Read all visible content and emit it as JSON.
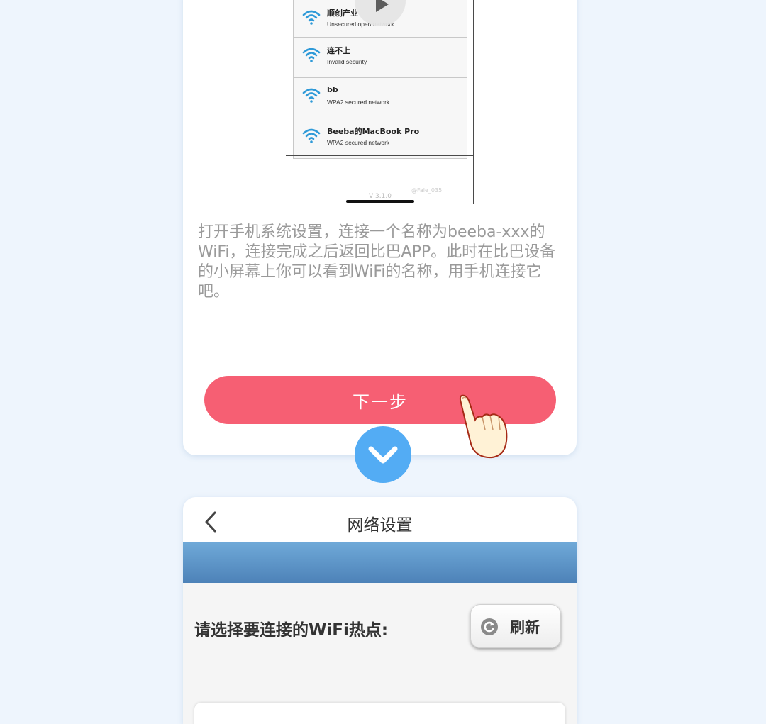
{
  "tutorial_step": {
    "wifi_networks": [
      {
        "name": "顺创产业",
        "status": "Unsecured open network"
      },
      {
        "name": "连不上",
        "status": "Invalid security"
      },
      {
        "name": "bb",
        "status": "WPA2 secured network"
      },
      {
        "name": "Beeba的MacBook Pro",
        "status": "WPA2 secured network"
      }
    ],
    "version": "V 3.1.0",
    "watermark": "@Fale_035",
    "instruction": "打开手机系统设置，连接一个名称为beeba-xxx的WiFi，连接完成之后返回比巴APP。此时在比巴设备的小屏幕上你可以看到WiFi的名称，用手机连接它吧。",
    "next_label": "下一步"
  },
  "network_settings": {
    "title": "网络设置",
    "prompt": "请选择要连接的WiFi热点:",
    "refresh_label": "刷新"
  },
  "colors": {
    "next_button": "#f65f73",
    "arrow_circle": "#53acf4",
    "header_band": "#5b8fc4",
    "page_background": "#eef5fd"
  },
  "icons": [
    "wifi-icon",
    "play-icon",
    "pointing-hand-icon",
    "chevron-down-icon",
    "back-arrow-icon",
    "refresh-icon"
  ]
}
